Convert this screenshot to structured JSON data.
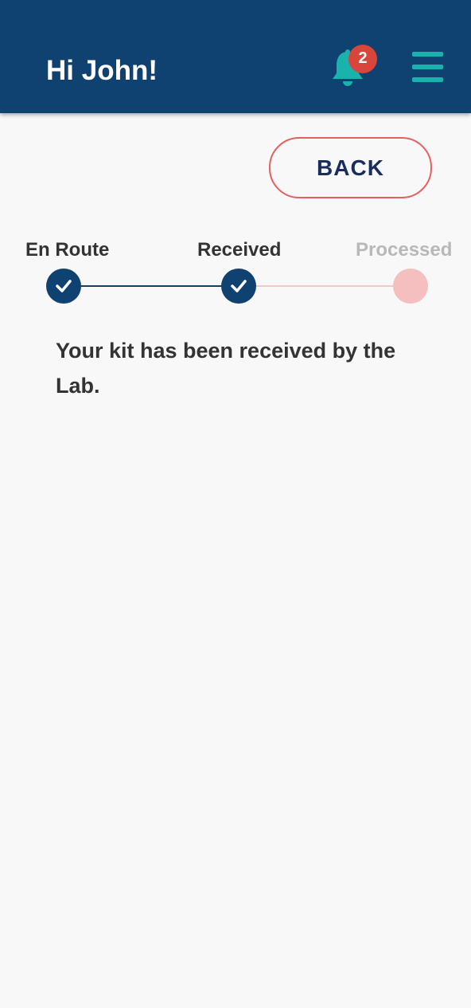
{
  "header": {
    "greeting": "Hi John!",
    "notification_count": "2",
    "background_color": "#0f4271",
    "accent_color": "#19b3ab",
    "badge_color": "#d9443b",
    "bell_icon": "bell-icon",
    "menu_icon": "hamburger-menu-icon"
  },
  "actions": {
    "back_label": "BACK"
  },
  "progress": {
    "steps": [
      {
        "label": "En Route",
        "status": "complete"
      },
      {
        "label": "Received",
        "status": "complete"
      },
      {
        "label": "Processed",
        "status": "pending"
      }
    ],
    "complete_color": "#0f4271",
    "pending_color": "#f5bfbf"
  },
  "status_message": "Your kit has been received by the Lab."
}
